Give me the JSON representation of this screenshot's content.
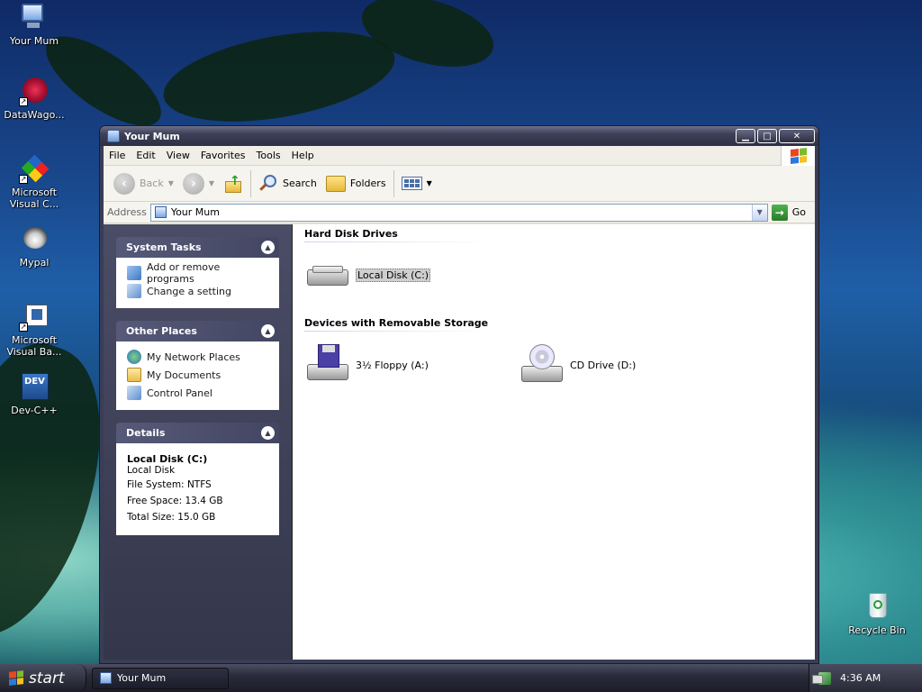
{
  "desktop": {
    "icons": [
      {
        "label": "Your Mum",
        "icon": "computer-icon"
      },
      {
        "label": "DataWago...",
        "icon": "datawagon-icon"
      },
      {
        "label": "Microsoft Visual C...",
        "icon": "visual-c-icon"
      },
      {
        "label": "Mypal",
        "icon": "mypal-icon"
      },
      {
        "label": "Microsoft Visual Ba...",
        "icon": "visual-basic-icon"
      },
      {
        "label": "Dev-C++",
        "icon": "devcpp-icon"
      },
      {
        "label": "Recycle Bin",
        "icon": "recycle-bin-icon"
      }
    ]
  },
  "window": {
    "title": "Your Mum",
    "menu": [
      "File",
      "Edit",
      "View",
      "Favorites",
      "Tools",
      "Help"
    ],
    "toolbar": {
      "back": "Back",
      "search": "Search",
      "folders": "Folders"
    },
    "address": {
      "label": "Address",
      "value": "Your Mum",
      "go": "Go"
    },
    "left_pane": {
      "system_tasks": {
        "title": "System Tasks",
        "items": [
          "Add or remove programs",
          "Change a setting"
        ]
      },
      "other_places": {
        "title": "Other Places",
        "items": [
          "My Network Places",
          "My Documents",
          "Control Panel"
        ]
      },
      "details": {
        "title": "Details",
        "name": "Local Disk (C:)",
        "type": "Local Disk",
        "file_system": "File System: NTFS",
        "free_space": "Free Space: 13.4 GB",
        "total_size": "Total Size: 15.0 GB"
      }
    },
    "content": {
      "hard_disk_title": "Hard Disk Drives",
      "hard_disks": [
        {
          "label": "Local Disk (C:)",
          "selected": true
        }
      ],
      "removable_title": "Devices with Removable Storage",
      "removable": [
        {
          "label": "3½ Floppy (A:)"
        },
        {
          "label": "CD Drive (D:)"
        }
      ]
    }
  },
  "taskbar": {
    "start": "start",
    "task": "Your Mum",
    "clock": "4:36 AM"
  }
}
